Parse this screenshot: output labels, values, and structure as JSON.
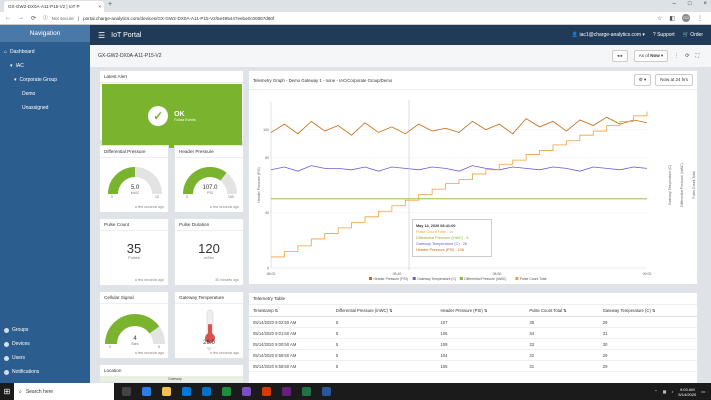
{
  "browser": {
    "tab_title": "GX-GW2-DX0A-A11-P15-V2 | IoT P",
    "tab_close": "×",
    "new_tab": "+",
    "window_controls": [
      "–",
      "□",
      "×"
    ],
    "not_secure": "Not secure",
    "url": "portal.charge-analytics.com/devices/GX-GW2-DX0A-A11-P15-V2/5e495447eebe0c00067d60f",
    "profile_initials": "GO"
  },
  "app": {
    "title": "IoT Portal",
    "user_email": "iac1@charge-analytics.com",
    "support_label": "Support",
    "order_label": "Order"
  },
  "sidebar": {
    "heading": "Navigation",
    "items": [
      {
        "label": "Dashboard",
        "level": 0
      },
      {
        "label": "IAC",
        "level": 1
      },
      {
        "label": "Corporate Group",
        "level": 2
      },
      {
        "label": "Demo",
        "level": 3
      },
      {
        "label": "Unassigned",
        "level": 3
      }
    ],
    "bottom_items": [
      {
        "label": "Groups"
      },
      {
        "label": "Devices"
      },
      {
        "label": "Users"
      },
      {
        "label": "Notifications"
      }
    ]
  },
  "device": {
    "id": "GX-GW2-DX0A-A11-P15-V2",
    "as_of_label": "As of",
    "as_of_value": "Now"
  },
  "latest_alert": {
    "title": "Latest Alert",
    "status": "OK",
    "sub": "Follow Events"
  },
  "widgets": {
    "diff_pressure": {
      "title": "Differential Pressure",
      "value": "5.0",
      "unit": "inWC",
      "min": "0",
      "max": "10",
      "fraction": 0.5,
      "ago": "a few seconds ago"
    },
    "header_pressure": {
      "title": "Header Pressure",
      "value": "107.0",
      "unit": "PSI",
      "min": "0",
      "max": "150",
      "fraction": 0.71,
      "ago": "a few seconds ago"
    },
    "pulse_count": {
      "title": "Pulse Count",
      "value": "35",
      "unit": "Pulses",
      "ago": "a few seconds ago"
    },
    "pulse_duration": {
      "title": "Pulse Duration",
      "value": "120",
      "unit": "mSec",
      "ago": "30 minutes ago"
    },
    "cellular": {
      "title": "Cellular Signal",
      "value": "4",
      "unit": "Bars",
      "min": "0",
      "max": "5",
      "fraction": 0.8,
      "ago": "a few seconds ago"
    },
    "gateway_temp": {
      "title": "Gateway Temperature",
      "value": "26.0",
      "unit": "°C",
      "fraction": 0.45,
      "ago": "a few seconds ago"
    },
    "location": {
      "title": "Location",
      "map_label": "Gateway"
    }
  },
  "chart_data": {
    "type": "line",
    "title": "Telemetry Graph - Demo Gateway 1 - none - IAC/Corporate Group/Demo",
    "range_label": "Now at 24 hrs",
    "y_left_label": "Header Pressure (PSI)",
    "y_right_label_1": "Gateway Temperature (C)",
    "y_right_label_2": "Differential Pressure (inWC)",
    "y_right_label_3": "Pulse Count Total",
    "y_left_ticks": [
      "0",
      "40",
      "80",
      "100"
    ],
    "y_left_lim": [
      0,
      120
    ],
    "x_ticks": [
      "08:00",
      "08:40",
      "08:50",
      "09:00"
    ],
    "series": [
      {
        "name": "Header Pressure (PSI)",
        "color": "#c56a12",
        "values": [
          98,
          104,
          97,
          106,
          99,
          103,
          96,
          105,
          98,
          102,
          97,
          104,
          99,
          101,
          98,
          106,
          100,
          104,
          97,
          108,
          102,
          106,
          99,
          107,
          103,
          109,
          104,
          107,
          105
        ]
      },
      {
        "name": "Gateway Temperature (C)",
        "color": "#6f5bd6",
        "values": [
          71,
          73,
          70,
          74,
          72,
          72,
          71,
          73,
          70,
          73,
          72,
          71,
          73,
          72,
          70,
          74,
          72,
          71,
          73,
          72,
          71,
          73,
          72,
          70,
          73,
          72,
          71,
          73,
          72
        ]
      },
      {
        "name": "Differential Pressure (inWC)",
        "color": "#8db331",
        "values": [
          50,
          50,
          50,
          50,
          50,
          50,
          50,
          50,
          50,
          50,
          50,
          50,
          50,
          50,
          50,
          50,
          50,
          50,
          50,
          50,
          50,
          50,
          50,
          50,
          50,
          50,
          50,
          50,
          50
        ]
      },
      {
        "name": "Pulse Count Total",
        "color": "#f0a040",
        "values": [
          8,
          12,
          16,
          21,
          25,
          29,
          33,
          37,
          41,
          45,
          49,
          53,
          57,
          61,
          64,
          68,
          71,
          75,
          78,
          82,
          85,
          89,
          92,
          96,
          99,
          103,
          106,
          110,
          113
        ]
      }
    ],
    "tooltip": {
      "time": "May 14, 2020 08:41:00",
      "rows": [
        {
          "text": "Pulse Count Total : 1s",
          "color": "#f0a040"
        },
        {
          "text": "Differential Pressure (inWC) : 5",
          "color": "#8db331"
        },
        {
          "text": "Gateway Temperature (C) : 26",
          "color": "#6f5bd6"
        },
        {
          "text": "Header Pressure (PSI) : 106",
          "color": "#c56a12"
        }
      ]
    },
    "legend_position": "bottom-center"
  },
  "table": {
    "title": "Telemetry Table",
    "columns": [
      "Timestamp",
      "Differential Pressure (inWC)",
      "Header Pressure (PSI)",
      "Pulse Count Total",
      "Gateway Temperature (C)"
    ],
    "rows": [
      [
        "05/14/2020 9:02:50 AM",
        "5",
        "107",
        "35",
        "29"
      ],
      [
        "05/14/2020 9:01:50 AM",
        "5",
        "105",
        "34",
        "31"
      ],
      [
        "05/14/2020 9:00:50 AM",
        "5",
        "109",
        "33",
        "30"
      ],
      [
        "05/14/2020 8:59:50 AM",
        "5",
        "104",
        "32",
        "29"
      ],
      [
        "05/14/2020 8:58:50 AM",
        "5",
        "105",
        "31",
        "29"
      ]
    ]
  },
  "taskbar": {
    "search_placeholder": "Search here",
    "time": "9:03 AM",
    "date": "5/14/2020"
  }
}
